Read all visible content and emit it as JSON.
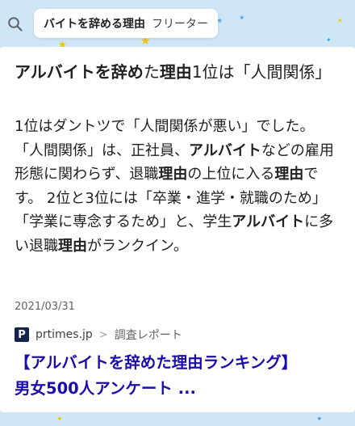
{
  "search": {
    "query_bold": "バイトを辞める理由",
    "query_rest": "フリーター"
  },
  "snippet": {
    "headline": [
      {
        "text": "アルバイトを辞め",
        "bold": true
      },
      {
        "text": "た",
        "bold": false
      },
      {
        "text": "理由",
        "bold": true
      },
      {
        "text": "1位は「人間関係」",
        "bold": false
      }
    ],
    "body": [
      {
        "text": "1位はダントツで「人間関係が悪い」でした。 「人間関係」は、正社員、",
        "bold": false
      },
      {
        "text": "アルバイト",
        "bold": true
      },
      {
        "text": "などの雇用形態に関わらず、退職",
        "bold": false
      },
      {
        "text": "理由",
        "bold": true
      },
      {
        "text": "の上位に入る",
        "bold": false
      },
      {
        "text": "理由",
        "bold": true
      },
      {
        "text": "です。 2位と3位には「卒業・進学・就職のため」「学業に専念するため」と、学生",
        "bold": false
      },
      {
        "text": "アルバイト",
        "bold": true
      },
      {
        "text": "に多い退職",
        "bold": false
      },
      {
        "text": "理由",
        "bold": true
      },
      {
        "text": "がランクイン。",
        "bold": false
      }
    ],
    "date": "2021/03/31"
  },
  "source": {
    "logo_letter": "P",
    "domain": "prtimes.jp",
    "separator": ">",
    "breadcrumb": "調査レポート"
  },
  "result": {
    "title_line1": "【アルバイトを辞めた理由ランキング】",
    "title_line2": "男女500人アンケート ..."
  },
  "colors": {
    "background": "#cfe6f7",
    "link": "#1a0dab",
    "logo_bg": "#14244f"
  },
  "icons": {
    "search": "search-icon",
    "source_logo": "prtimes-logo"
  }
}
